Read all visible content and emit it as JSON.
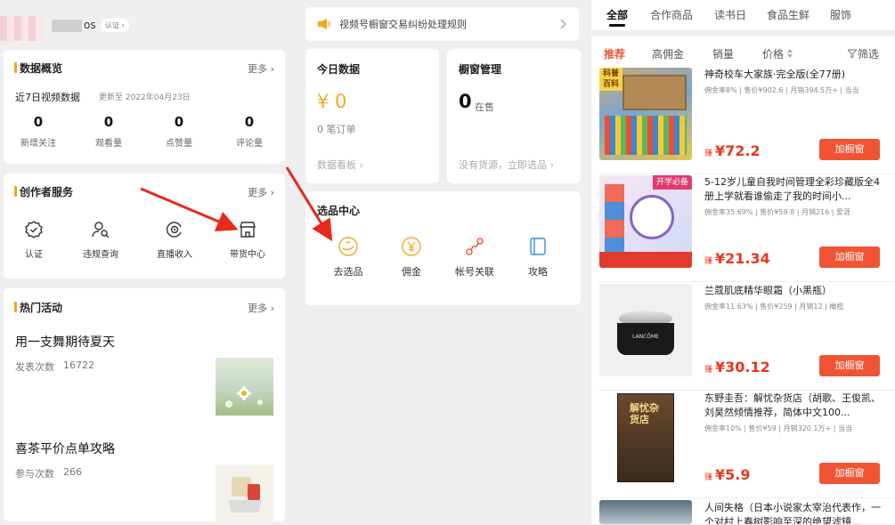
{
  "account": {
    "name_suffix": "os",
    "badge": "认证 ›"
  },
  "overview": {
    "title": "数据概览",
    "more": "更多 ›",
    "range_label": "近7日视频数据",
    "updated": "更新至 2022年04月23日",
    "stats": [
      {
        "value": "0",
        "label": "新增关注"
      },
      {
        "value": "0",
        "label": "观看量"
      },
      {
        "value": "0",
        "label": "点赞量"
      },
      {
        "value": "0",
        "label": "评论量"
      }
    ]
  },
  "creator": {
    "title": "创作者服务",
    "more": "更多 ›",
    "items": [
      {
        "label": "认证",
        "icon": "verified-badge-icon"
      },
      {
        "label": "违规查询",
        "icon": "user-search-icon"
      },
      {
        "label": "直播收入",
        "icon": "live-income-icon"
      },
      {
        "label": "带货中心",
        "icon": "store-icon"
      }
    ]
  },
  "hot": {
    "title": "热门活动",
    "more": "更多 ›",
    "items": [
      {
        "title": "用一支舞期待夏天",
        "count_label": "发表次数",
        "count": "16722"
      },
      {
        "title": "喜茶平价点单攻略",
        "count_label": "参与次数",
        "count": "266"
      }
    ]
  },
  "notice": {
    "text": "视频号橱窗交易纠纷处理规则"
  },
  "today": {
    "title": "今日数据",
    "amount": "¥ 0",
    "orders": "0 笔订单",
    "link": "数据看板 ›"
  },
  "showcase": {
    "title": "橱窗管理",
    "count": "0",
    "count_unit": "在售",
    "link": "没有货源，立即选品 ›"
  },
  "selection": {
    "title": "选品中心",
    "items": [
      {
        "label": "去选品",
        "icon": "pick-products-icon"
      },
      {
        "label": "佣金",
        "icon": "yen-coin-icon"
      },
      {
        "label": "帐号关联",
        "icon": "account-link-icon"
      },
      {
        "label": "攻略",
        "icon": "guide-book-icon"
      }
    ]
  },
  "tabs": [
    "全部",
    "合作商品",
    "读书日",
    "食品生鲜",
    "服饰"
  ],
  "subtabs": [
    "推荐",
    "高佣金",
    "销量",
    "价格",
    "筛选"
  ],
  "products": [
    {
      "name": "神奇校车大家族·完全版(全77册)",
      "meta": "佣金率8% | 售价¥902.6 | 月销394.5万+ | 当当",
      "price": "¥72.2",
      "btn": "加橱窗",
      "img_text": "科普\n百科"
    },
    {
      "name": "5-12岁儿童自我时间管理全彩珍藏版全4册上学就看谁偷走了我的时间小...",
      "meta": "佣金率35.69% | 售价¥59.8 | 月销216 | 爱涯",
      "price": "¥21.34",
      "btn": "加橱窗",
      "img_text": "开学必备"
    },
    {
      "name": "兰蔻肌底精华眼霜（小黑瓶）",
      "meta": "佣金率11.63% | 售价¥259 | 月销12 | 橄榄",
      "price": "¥30.12",
      "btn": "加橱窗",
      "img_text": "LANCÔME"
    },
    {
      "name": "东野圭吾：解忧杂货店（胡歌、王俊凯、刘昊然倾情推荐，简体中文100...",
      "meta": "佣金率10% | 售价¥59 | 月销320.1万+ | 当当",
      "price": "¥5.9",
      "btn": "加橱窗",
      "img_text": "解忧杂货店"
    },
    {
      "name": "人间失格（日本小说家太宰治代表作，一个对村上春树影响至深的绝望滤镜...",
      "meta": "",
      "price": "",
      "btn": "",
      "img_text": ""
    }
  ],
  "colors": {
    "accent": "#f5a623",
    "button": "#ef5534",
    "price": "#e8381e"
  }
}
